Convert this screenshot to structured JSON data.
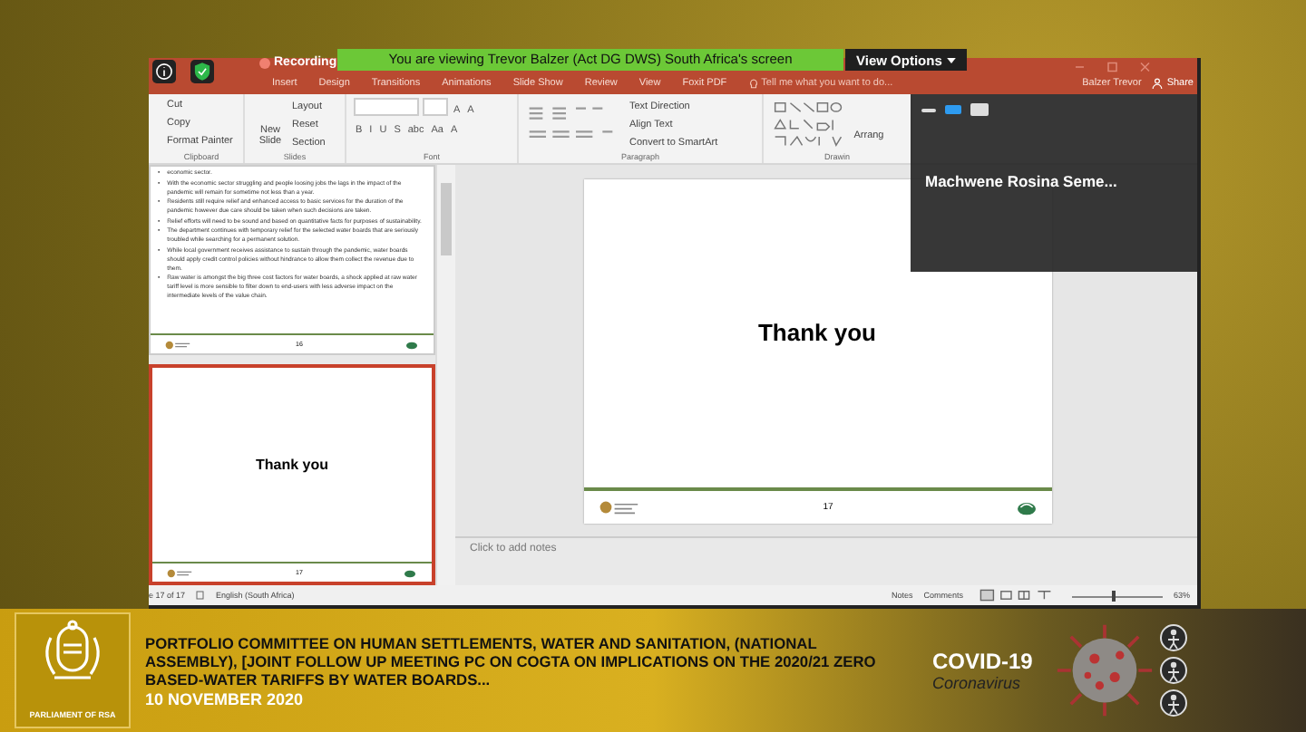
{
  "share_bar": {
    "recording": "Recording",
    "viewing": "You are viewing Trevor Balzer (Act DG DWS) South Africa's screen",
    "view_options": "View Options"
  },
  "app": {
    "tabs": [
      {
        "label": "Insert",
        "selected": false
      },
      {
        "label": "Design",
        "selected": false
      },
      {
        "label": "Transitions",
        "selected": false
      },
      {
        "label": "Animations",
        "selected": false
      },
      {
        "label": "Slide Show",
        "selected": false
      },
      {
        "label": "Review",
        "selected": false
      },
      {
        "label": "View",
        "selected": false
      },
      {
        "label": "Foxit PDF",
        "selected": false
      }
    ],
    "tell_me": "Tell me what you want to do...",
    "user": "Balzer Trevor",
    "share": "Share",
    "ribbon": {
      "clipboard": {
        "items": [
          "Cut",
          "Copy",
          "Format Painter"
        ],
        "label": "Clipboard"
      },
      "slides": {
        "new_slide": "New Slide",
        "items": [
          "Layout",
          "Reset",
          "Section"
        ],
        "label": "Slides"
      },
      "font": {
        "size_buttons": [
          "A",
          "A"
        ],
        "format_buttons": [
          "B",
          "I",
          "U",
          "S",
          "abc",
          "Aa",
          "A"
        ],
        "label": "Font"
      },
      "paragraph": {
        "items": [
          "Text Direction",
          "Align Text",
          "Convert to SmartArt"
        ],
        "label": "Paragraph"
      },
      "drawing": {
        "arrange": "Arrang",
        "label": "Drawin"
      }
    },
    "thumbnails": [
      {
        "selected": false,
        "kind": "bullets",
        "marker": "•",
        "bullets": [
          "economic sector.",
          "With the economic sector struggling and people loosing jobs the lags in the impact of the pandemic will remain for sometime not less than a year.",
          "Residents still require relief and enhanced access to basic services for the duration of the pandemic however due care should be taken when such decisions are taken.",
          "Relief efforts will need to be sound and based on quantitative facts for purposes of sustainability.",
          "The department continues with temporary relief for the selected water boards that are seriously troubled while searching for a permanent solution.",
          "While local government receives assistance to sustain through the pandemic, water boards should apply credit control policies without hindrance to allow them collect the revenue due to them.",
          "Raw water is amongst the big three cost factors for water boards, a shock applied at raw water tariff level is more sensible to filter down to end-users with less adverse impact on the intermediate levels of the value chain."
        ],
        "number": "16"
      },
      {
        "selected": true,
        "kind": "title",
        "title": "Thank you",
        "number": "17"
      }
    ],
    "slide": {
      "title": "Thank you",
      "number": "17"
    },
    "notes_placeholder": "Click to add notes",
    "status": {
      "slide_count": "e 17 of 17",
      "language": "English (South Africa)",
      "notes": "Notes",
      "comments": "Comments",
      "zoom_slider": {
        "level": 0.45
      },
      "zoom": "63%"
    }
  },
  "video_panel": {
    "participant": "Machwene Rosina Seme..."
  },
  "banner": {
    "org": "PARLIAMENT OF RSA",
    "headline": "PORTFOLIO COMMITTEE ON HUMAN SETTLEMENTS, WATER AND SANITATION, (NATIONAL ASSEMBLY), [JOINT FOLLOW UP MEETING PC ON COGTA ON IMPLICATIONS ON THE 2020/21 ZERO BASED-WATER TARIFFS BY WATER BOARDS...",
    "date": "10 NOVEMBER 2020",
    "covid_title": "COVID-19",
    "covid_subtitle": "Coronavirus"
  }
}
